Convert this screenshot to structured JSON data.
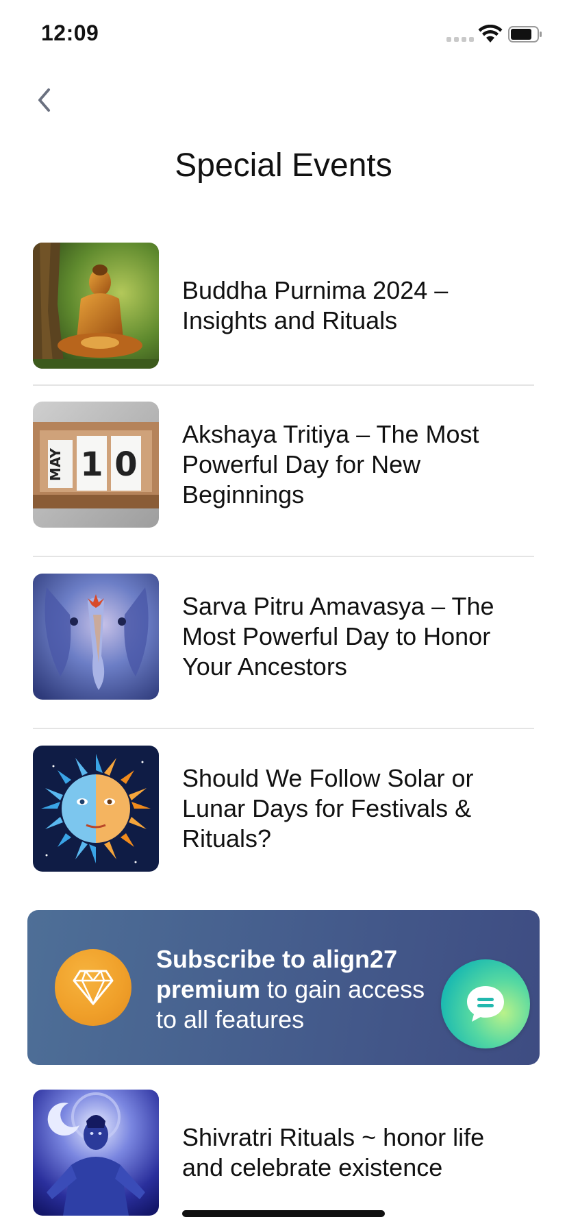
{
  "status_bar": {
    "time": "12:09",
    "icons": [
      "signal-icon",
      "wifi-icon",
      "battery-icon"
    ]
  },
  "nav": {
    "back_icon": "chevron-left-icon",
    "title": "Special Events"
  },
  "events": [
    {
      "title": "Buddha Purnima 2024 – Insights and Rituals",
      "image": "buddha-image"
    },
    {
      "title": "Akshaya Tritiya – The Most Powerful Day for New Beginnings",
      "image": "calendar-may-10-image",
      "image_text": [
        "MAY",
        "1",
        "0"
      ]
    },
    {
      "title": "Sarva Pitru Amavasya – The Most Powerful Day to Honor Your Ancestors",
      "image": "ganesha-image"
    },
    {
      "title": "Should We Follow Solar or Lunar Days for Festivals & Rituals?",
      "image": "sun-moon-image"
    },
    {
      "title": "Shivratri Rituals ~ honor life and celebrate existence",
      "image": "shiva-image"
    }
  ],
  "premium_banner": {
    "text_bold": "Subscribe to align27 premium",
    "text_rest": " to gain access to all features",
    "icon": "diamond-icon"
  },
  "chat_fab": {
    "icon": "chat-bubble-icon"
  },
  "colors": {
    "banner_start": "#4e6f97",
    "banner_end": "#3e4c82",
    "badge_orange": "#f0a02a",
    "fab_teal": "#1dbbb0",
    "divider": "#e4e4e4"
  }
}
